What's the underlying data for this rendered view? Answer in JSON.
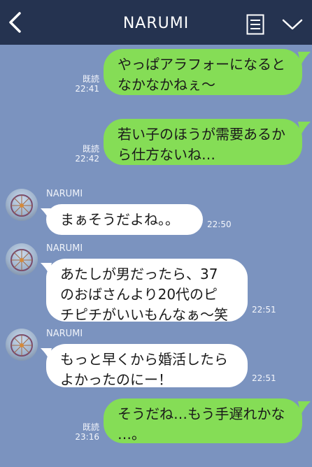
{
  "header": {
    "title": "NARUMI"
  },
  "messages": [
    {
      "dir": "out",
      "text": "やっぱアラフォーになると\nなかなかねぇ〜",
      "read": "既読",
      "time": "22:41"
    },
    {
      "dir": "out",
      "text": "若い子のほうが需要あるか\nら仕方ないね…",
      "read": "既読",
      "time": "22:42"
    },
    {
      "dir": "in",
      "sender": "NARUMI",
      "text": "まぁそうだよね。。",
      "time": "22:50"
    },
    {
      "dir": "in",
      "sender": "NARUMI",
      "text": "あたしが男だったら、37\nのおばさんより20代のピ\nチピチがいいもんなぁ〜笑",
      "time": "22:51"
    },
    {
      "dir": "in",
      "sender": "NARUMI",
      "text": "もっと早くから婚活したら\nよかったのにー！",
      "time": "22:51"
    },
    {
      "dir": "out",
      "text": "そうだね…もう手遅れかな\n…。",
      "read": "既読",
      "time": "23:16"
    }
  ],
  "colors": {
    "header": "#253350",
    "background": "#7b93bf",
    "outgoing": "#85dd56",
    "incoming": "#ffffff"
  },
  "icons": {
    "back": "chevron-left-icon",
    "note": "note-icon",
    "menu": "chevron-down-icon"
  }
}
